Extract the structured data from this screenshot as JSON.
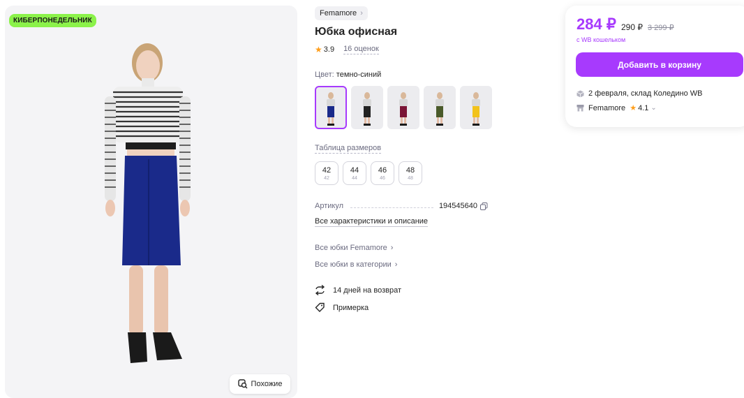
{
  "gallery": {
    "badge": "КИБЕРПОНЕДЕЛЬНИК",
    "similar_label": "Похожие"
  },
  "product": {
    "brand": "Femamore",
    "title": "Юбка офисная",
    "rating": "3.9",
    "reviews": "16 оценок",
    "color_label": "Цвет:",
    "color_value": "темно-синий",
    "swatches": [
      {
        "color": "#1a2a8a",
        "active": true
      },
      {
        "color": "#222222",
        "active": false
      },
      {
        "color": "#7a1535",
        "active": false
      },
      {
        "color": "#4a5a2a",
        "active": false
      },
      {
        "color": "#f2c21a",
        "active": false
      }
    ],
    "size_table_label": "Таблица размеров",
    "sizes": [
      {
        "main": "42",
        "sub": "42"
      },
      {
        "main": "44",
        "sub": "44"
      },
      {
        "main": "46",
        "sub": "46"
      },
      {
        "main": "48",
        "sub": "48"
      }
    ],
    "article_label": "Артикул",
    "article_value": "194545640",
    "all_characteristics": "Все характеристики и описание",
    "all_brand_skirts": "Все юбки Femamore",
    "all_category_skirts": "Все юбки в категории",
    "return_policy": "14 дней на возврат",
    "fitting": "Примерка"
  },
  "price_card": {
    "price": "284 ₽",
    "old_price": "290 ₽",
    "crossed_price": "3 299 ₽",
    "wallet_note": "с WB кошельком",
    "add_to_cart": "Добавить в корзину",
    "delivery": "2 февраля, склад Коледино WB",
    "seller_name": "Femamore",
    "seller_rating": "4.1"
  },
  "colors": {
    "accent": "#a73afd",
    "promo": "#8bf24a",
    "star": "#ff9e1b",
    "skirt": "#1a2a8a"
  }
}
